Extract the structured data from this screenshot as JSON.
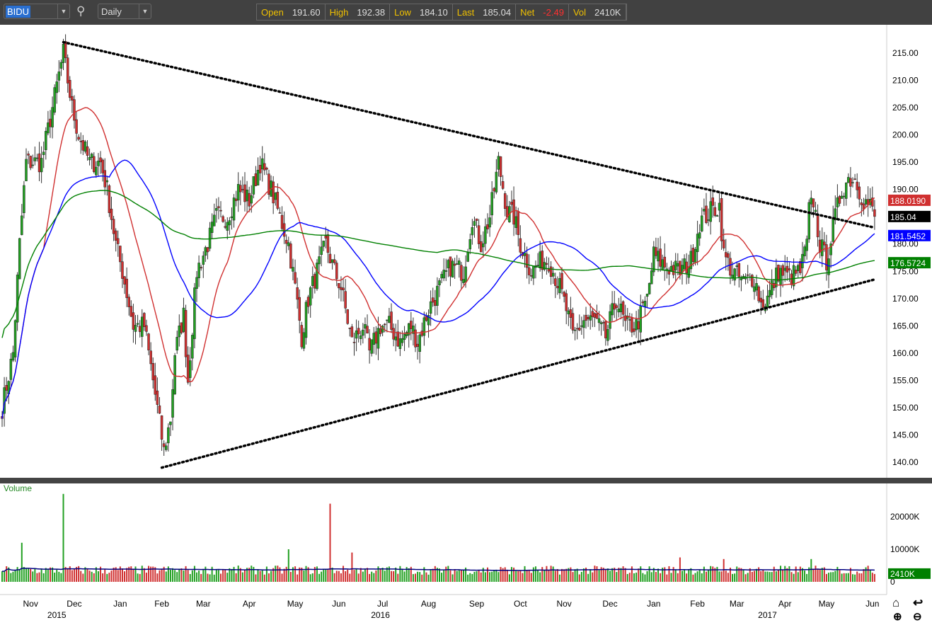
{
  "toolbar": {
    "symbol": "BIDU",
    "interval": "Daily",
    "quote": [
      {
        "label": "Open",
        "value": "191.60"
      },
      {
        "label": "High",
        "value": "192.38"
      },
      {
        "label": "Low",
        "value": "184.10"
      },
      {
        "label": "Last",
        "value": "185.04"
      },
      {
        "label": "Net",
        "value": "-2.49"
      },
      {
        "label": "Vol",
        "value": "2410K"
      }
    ]
  },
  "price_axis": {
    "ticks": [
      "215.00",
      "210.00",
      "205.00",
      "200.00",
      "195.00",
      "190.00",
      "185.00",
      "180.00",
      "175.00",
      "170.00",
      "165.00",
      "160.00",
      "155.00",
      "150.00",
      "145.00",
      "140.00"
    ],
    "tick_values": [
      215,
      210,
      205,
      200,
      195,
      190,
      185,
      180,
      175,
      170,
      165,
      160,
      155,
      150,
      145,
      140
    ],
    "badges": [
      {
        "text": "188.0190",
        "value": 188.019,
        "color": "#d03030"
      },
      {
        "text": "185.04",
        "value": 185.04,
        "color": "#000000"
      },
      {
        "text": "181.5452",
        "value": 181.5452,
        "color": "#0000ff"
      },
      {
        "text": "176.5724",
        "value": 176.5724,
        "color": "#008000"
      }
    ]
  },
  "volume_panel": {
    "title": "Volume",
    "ticks": [
      "20000K",
      "10000K",
      "0"
    ],
    "tick_values": [
      20000,
      10000,
      0
    ],
    "badge": "2410K",
    "badge_value": 2410
  },
  "time_axis": {
    "months": [
      {
        "l": "Nov",
        "d": 13
      },
      {
        "l": "Dec",
        "d": 33
      },
      {
        "l": "Jan",
        "d": 54
      },
      {
        "l": "Feb",
        "d": 73
      },
      {
        "l": "Mar",
        "d": 92
      },
      {
        "l": "Apr",
        "d": 113
      },
      {
        "l": "May",
        "d": 134
      },
      {
        "l": "Jun",
        "d": 154
      },
      {
        "l": "Jul",
        "d": 174
      },
      {
        "l": "Aug",
        "d": 195
      },
      {
        "l": "Sep",
        "d": 217
      },
      {
        "l": "Oct",
        "d": 237
      },
      {
        "l": "Nov",
        "d": 257
      },
      {
        "l": "Dec",
        "d": 278
      },
      {
        "l": "Jan",
        "d": 298
      },
      {
        "l": "Feb",
        "d": 318
      },
      {
        "l": "Mar",
        "d": 336
      },
      {
        "l": "Apr",
        "d": 358
      },
      {
        "l": "May",
        "d": 377
      },
      {
        "l": "Jun",
        "d": 398
      }
    ],
    "years": [
      {
        "l": "2015",
        "d": 25
      },
      {
        "l": "2016",
        "d": 173
      },
      {
        "l": "2017",
        "d": 350
      }
    ]
  },
  "chart_data": {
    "type": "candlestick",
    "days": 400,
    "ylim": [
      137,
      220
    ],
    "close_keypoints": [
      [
        0,
        150
      ],
      [
        5,
        160
      ],
      [
        8,
        180
      ],
      [
        11,
        195
      ],
      [
        18,
        195
      ],
      [
        23,
        205
      ],
      [
        28,
        215
      ],
      [
        32,
        205
      ],
      [
        35,
        200
      ],
      [
        40,
        195
      ],
      [
        45,
        195
      ],
      [
        48,
        190
      ],
      [
        52,
        180
      ],
      [
        55,
        175
      ],
      [
        60,
        165
      ],
      [
        65,
        165
      ],
      [
        69,
        155
      ],
      [
        74,
        142
      ],
      [
        77,
        148
      ],
      [
        79,
        160
      ],
      [
        83,
        167
      ],
      [
        85,
        155
      ],
      [
        89,
        175
      ],
      [
        94,
        180
      ],
      [
        98,
        185
      ],
      [
        103,
        185
      ],
      [
        108,
        190
      ],
      [
        113,
        188
      ],
      [
        118,
        195
      ],
      [
        123,
        190
      ],
      [
        127,
        185
      ],
      [
        131,
        180
      ],
      [
        134,
        172
      ],
      [
        137,
        163
      ],
      [
        140,
        170
      ],
      [
        144,
        175
      ],
      [
        148,
        180
      ],
      [
        152,
        175
      ],
      [
        155,
        172
      ],
      [
        160,
        162
      ],
      [
        165,
        165
      ],
      [
        168,
        160
      ],
      [
        173,
        165
      ],
      [
        177,
        165
      ],
      [
        182,
        162
      ],
      [
        187,
        165
      ],
      [
        190,
        162
      ],
      [
        195,
        168
      ],
      [
        200,
        172
      ],
      [
        205,
        176
      ],
      [
        211,
        175
      ],
      [
        215,
        185
      ],
      [
        219,
        180
      ],
      [
        223,
        185
      ],
      [
        227,
        195
      ],
      [
        231,
        186
      ],
      [
        234,
        185
      ],
      [
        237,
        180
      ],
      [
        242,
        175
      ],
      [
        247,
        177
      ],
      [
        250,
        177
      ],
      [
        255,
        172
      ],
      [
        258,
        168
      ],
      [
        261,
        163
      ],
      [
        266,
        166
      ],
      [
        271,
        166
      ],
      [
        276,
        163
      ],
      [
        281,
        170
      ],
      [
        285,
        165
      ],
      [
        290,
        165
      ],
      [
        295,
        170
      ],
      [
        298,
        178
      ],
      [
        303,
        176
      ],
      [
        310,
        175
      ],
      [
        315,
        177
      ],
      [
        319,
        184
      ],
      [
        324,
        186
      ],
      [
        328,
        187
      ],
      [
        330,
        178
      ],
      [
        334,
        175
      ],
      [
        339,
        173
      ],
      [
        344,
        174
      ],
      [
        347,
        169
      ],
      [
        350,
        170
      ],
      [
        355,
        175
      ],
      [
        360,
        174
      ],
      [
        365,
        175
      ],
      [
        368,
        180
      ],
      [
        369,
        186
      ],
      [
        371,
        188
      ],
      [
        374,
        180
      ],
      [
        377,
        177
      ],
      [
        381,
        185
      ],
      [
        384,
        190
      ],
      [
        387,
        192
      ],
      [
        390,
        192
      ],
      [
        394,
        188
      ],
      [
        397,
        187
      ],
      [
        399,
        185
      ]
    ],
    "volume_spikes": [
      [
        9,
        12000
      ],
      [
        28,
        27000
      ],
      [
        150,
        24000
      ],
      [
        131,
        10000
      ],
      [
        160,
        9000
      ],
      [
        310,
        7500
      ],
      [
        330,
        7000
      ],
      [
        370,
        7000
      ]
    ],
    "moving_averages": [
      {
        "period": 20,
        "color": "#d03030"
      },
      {
        "period": 50,
        "color": "#0000ff"
      },
      {
        "period": 200,
        "color": "#008000"
      }
    ],
    "trendlines": [
      {
        "from": [
          28,
          217
        ],
        "to": [
          399,
          183
        ]
      },
      {
        "from": [
          73,
          139
        ],
        "to": [
          399,
          173.5
        ]
      }
    ]
  }
}
